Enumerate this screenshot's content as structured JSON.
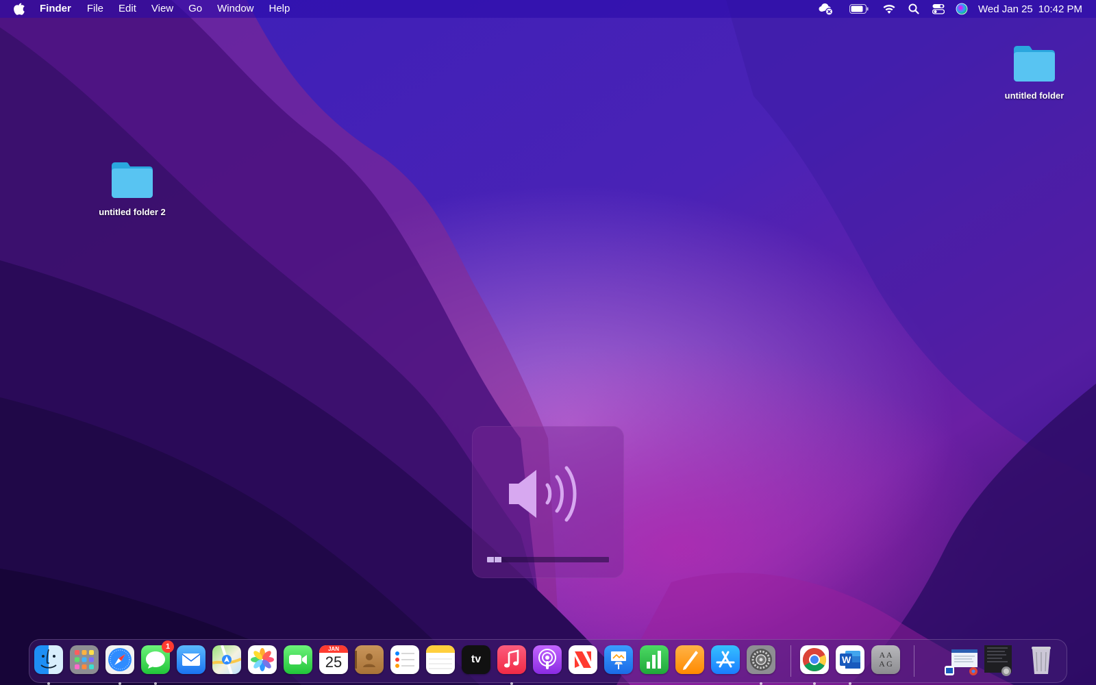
{
  "menubar": {
    "app_name": "Finder",
    "menus": [
      "File",
      "Edit",
      "View",
      "Go",
      "Window",
      "Help"
    ],
    "status_icons": [
      "cloud-error-icon",
      "battery-icon",
      "wifi-icon",
      "search-icon",
      "control-center-icon",
      "siri-icon"
    ],
    "clock": {
      "date": "Wed Jan 25",
      "time": "10:42 PM"
    }
  },
  "desktop": {
    "items": [
      {
        "label": "untitled folder",
        "icon": "folder-icon"
      },
      {
        "label": "untitled folder 2",
        "icon": "folder-icon"
      }
    ]
  },
  "volume_hud": {
    "icon": "speaker-icon",
    "level_percent": 12
  },
  "dock": {
    "apps": [
      {
        "name": "Finder",
        "icon": "finder-icon",
        "running": true
      },
      {
        "name": "Launchpad",
        "icon": "launchpad-icon",
        "running": false
      },
      {
        "name": "Safari",
        "icon": "safari-icon",
        "running": true
      },
      {
        "name": "Messages",
        "icon": "messages-icon",
        "running": true,
        "badge": "1"
      },
      {
        "name": "Mail",
        "icon": "mail-icon",
        "running": false
      },
      {
        "name": "Maps",
        "icon": "maps-icon",
        "running": false
      },
      {
        "name": "Photos",
        "icon": "photos-icon",
        "running": false
      },
      {
        "name": "FaceTime",
        "icon": "facetime-icon",
        "running": false
      },
      {
        "name": "Calendar",
        "icon": "calendar-icon",
        "running": false,
        "month": "JAN",
        "day": "25"
      },
      {
        "name": "Contacts",
        "icon": "contacts-icon",
        "running": false
      },
      {
        "name": "Reminders",
        "icon": "reminders-icon",
        "running": false
      },
      {
        "name": "Notes",
        "icon": "notes-icon",
        "running": false
      },
      {
        "name": "TV",
        "icon": "tv-icon",
        "running": false,
        "text": "tv"
      },
      {
        "name": "Music",
        "icon": "music-icon",
        "running": true
      },
      {
        "name": "Podcasts",
        "icon": "podcasts-icon",
        "running": false
      },
      {
        "name": "News",
        "icon": "news-icon",
        "running": false
      },
      {
        "name": "Keynote",
        "icon": "keynote-icon",
        "running": false
      },
      {
        "name": "Numbers",
        "icon": "numbers-icon",
        "running": false
      },
      {
        "name": "Pages",
        "icon": "pages-icon",
        "running": false
      },
      {
        "name": "App Store",
        "icon": "app-store-icon",
        "running": false
      },
      {
        "name": "System Preferences",
        "icon": "system-preferences-icon",
        "running": true
      },
      {
        "name": "Google Chrome",
        "icon": "chrome-icon",
        "running": true
      },
      {
        "name": "Microsoft Word",
        "icon": "word-icon",
        "running": true,
        "text": "W"
      },
      {
        "name": "Font Book",
        "icon": "font-book-icon",
        "running": false,
        "text": "A A\nA G"
      },
      {
        "name": "Word Document",
        "icon": "minimized-window-icon",
        "running": false
      },
      {
        "name": "Chrome Window",
        "icon": "minimized-window-icon",
        "running": false
      },
      {
        "name": "Trash",
        "icon": "trash-icon",
        "running": false
      }
    ]
  }
}
